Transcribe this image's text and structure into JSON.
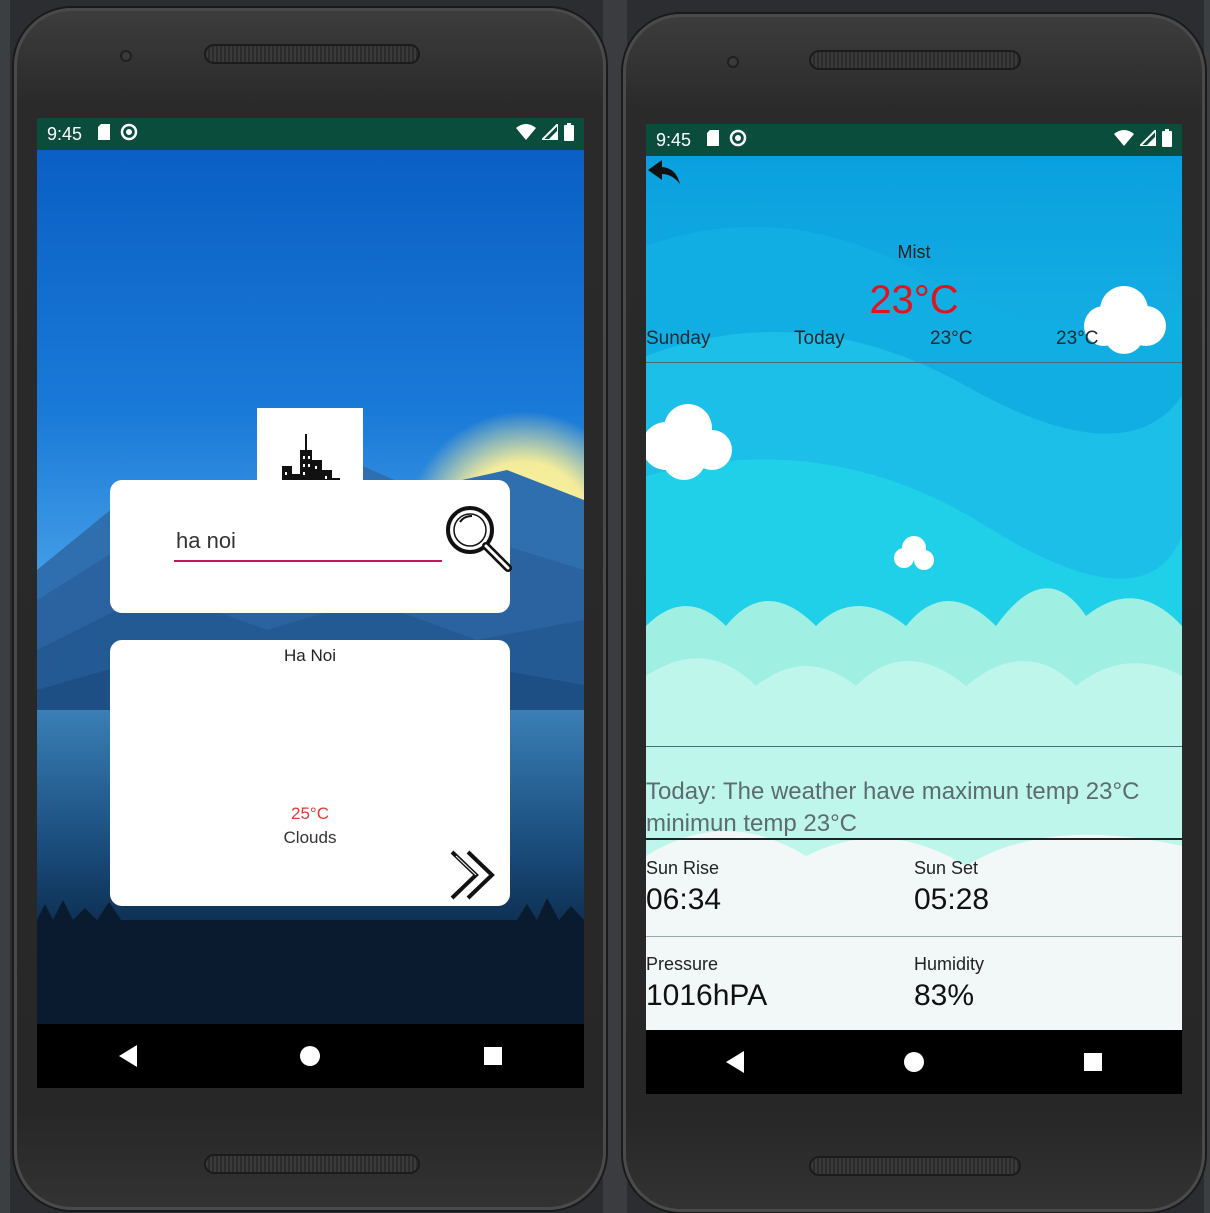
{
  "phone1": {
    "status": {
      "time": "9:45"
    },
    "search": {
      "value": "ha noi"
    },
    "result": {
      "city": "Ha Noi",
      "temp": "25°C",
      "description": "Clouds"
    }
  },
  "phone2": {
    "status": {
      "time": "9:45"
    },
    "current": {
      "description": "Mist",
      "temp": "23°C"
    },
    "forecast": {
      "day1": "Sunday",
      "day2": "Today",
      "temp1": "23°C",
      "temp2": "23°C"
    },
    "summary": {
      "line1": "Today: The weather have maximun temp 23°C",
      "line2": "minimun temp 23°C"
    },
    "details": {
      "sunrise_label": "Sun Rise",
      "sunrise_value": "06:34",
      "sunset_label": "Sun Set",
      "sunset_value": "05:28",
      "pressure_label": "Pressure",
      "pressure_value": "1016hPA",
      "humidity_label": "Humidity",
      "humidity_value": "83%"
    }
  },
  "colors": {
    "statusbar": "#0a4d3c",
    "accent_underline": "#c2185b",
    "temp_red": "#e0141a"
  }
}
